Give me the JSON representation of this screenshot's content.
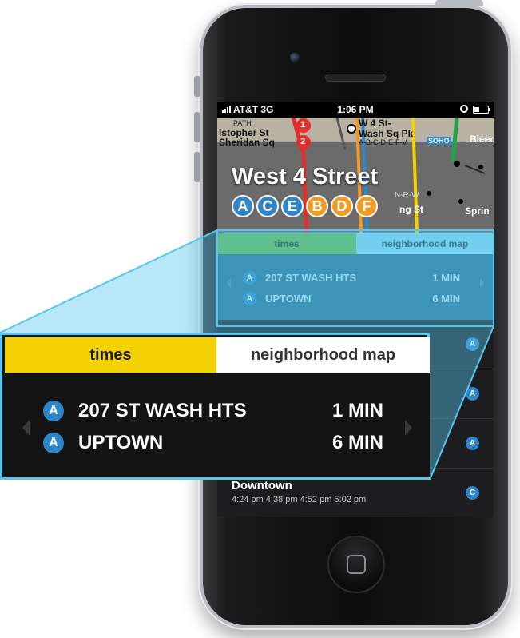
{
  "status_bar": {
    "carrier": "AT&T  3G",
    "time": "1:06 PM"
  },
  "map": {
    "labels": [
      "PATH",
      "istopher St",
      "Sheridan Sq",
      "W 4 St-",
      "Wash Sq Pk",
      "A-B-C-D-E-F-V",
      "SOHO",
      "Bleec",
      "N-R-W",
      "ng St",
      "Sprin"
    ],
    "line_badges": [
      "1",
      "2"
    ]
  },
  "station": {
    "name": "West 4 Street",
    "lines": [
      {
        "letter": "A",
        "color": "#2e86c8"
      },
      {
        "letter": "C",
        "color": "#2e86c8"
      },
      {
        "letter": "E",
        "color": "#2e86c8"
      },
      {
        "letter": "B",
        "color": "#f39a21"
      },
      {
        "letter": "D",
        "color": "#f39a21"
      },
      {
        "letter": "F",
        "color": "#f39a21"
      }
    ]
  },
  "tabs": {
    "times": "times",
    "neighborhood": "neighborhood map"
  },
  "arrivals": [
    {
      "line": "A",
      "destination": "207 ST WASH HTS",
      "eta": "1 MIN"
    },
    {
      "line": "A",
      "destination": "UPTOWN",
      "eta": "6 MIN"
    }
  ],
  "schedule": [
    {
      "direction": "",
      "times": "",
      "line": "A"
    },
    {
      "direction": "",
      "times": "",
      "line": "A"
    },
    {
      "direction": "",
      "times": "",
      "line": "A"
    },
    {
      "direction": "Downtown",
      "times": "4:24 pm  4:38 pm  4:52 pm  5:02 pm",
      "line": "C"
    }
  ],
  "colors": {
    "accent_blue": "#55c7ef",
    "times_tab": "#f3d200",
    "line_blue": "#2e86c8",
    "line_orange": "#f39a21"
  }
}
